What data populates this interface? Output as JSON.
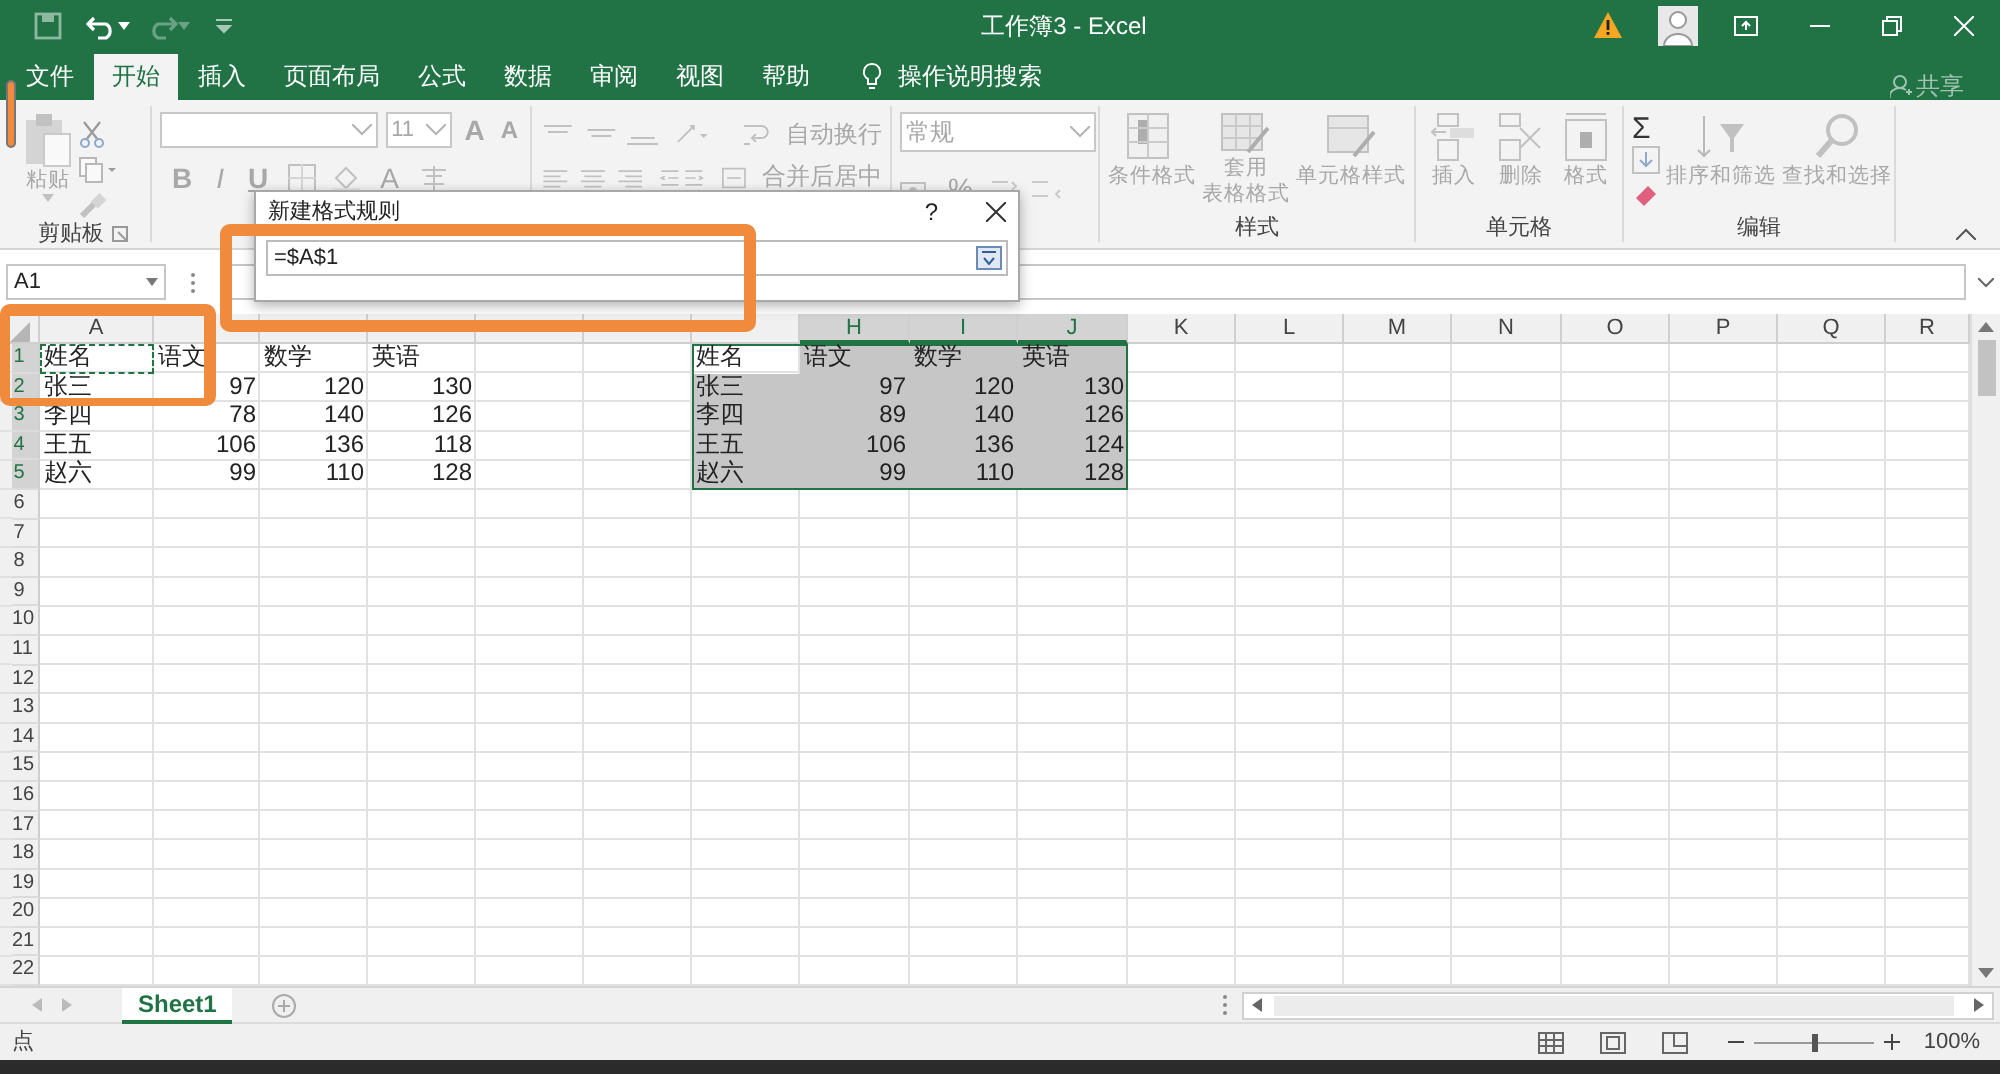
{
  "title_bar": {
    "title": "工作簿3 - Excel"
  },
  "tabs": [
    {
      "label": "文件",
      "selected": false
    },
    {
      "label": "开始",
      "selected": true
    },
    {
      "label": "插入",
      "selected": false
    },
    {
      "label": "页面布局",
      "selected": false
    },
    {
      "label": "公式",
      "selected": false
    },
    {
      "label": "数据",
      "selected": false
    },
    {
      "label": "审阅",
      "selected": false
    },
    {
      "label": "视图",
      "selected": false
    },
    {
      "label": "帮助",
      "selected": false
    }
  ],
  "tell_me": {
    "label": "操作说明搜索"
  },
  "share": {
    "label": "共享"
  },
  "ribbon": {
    "disabled": true,
    "clipboard": {
      "paste": "粘贴",
      "group_label": "剪贴板"
    },
    "font": {
      "size": "11",
      "grow": "A",
      "shrink": "A",
      "bold": "B",
      "italic": "I",
      "underline": "U",
      "text_color_button": "A"
    },
    "alignment": {
      "wrap_text": "自动换行",
      "merge_center": "合并后居中"
    },
    "number": {
      "format": "常规",
      "percent": "%"
    },
    "styles": {
      "conditional": "条件格式",
      "table_format": [
        "套用",
        "表格格式"
      ],
      "cell_styles": "单元格样式",
      "group_label": "样式"
    },
    "cells": {
      "insert": "插入",
      "delete": "删除",
      "format": "格式",
      "group_label": "单元格"
    },
    "editing": {
      "sum": "Σ",
      "sort_filter": "排序和筛选",
      "find_select": "查找和选择",
      "group_label": "编辑"
    }
  },
  "formula_bar": {
    "name_box": "A1"
  },
  "dialog": {
    "title": "新建格式规则",
    "help": "?",
    "formula": "=$A$1"
  },
  "sheet": {
    "columns": [
      {
        "label": "A",
        "selected": false
      },
      {
        "selected": false
      },
      {
        "selected": false
      },
      {
        "selected": false
      },
      {
        "selected": false
      },
      {
        "selected": false
      },
      {
        "selected": false
      },
      {
        "label": "H",
        "selected": true
      },
      {
        "label": "I",
        "selected": true
      },
      {
        "label": "J",
        "selected": true
      },
      {
        "label": "K",
        "selected": false
      },
      {
        "label": "L",
        "selected": false
      },
      {
        "label": "M",
        "selected": false
      },
      {
        "label": "N",
        "selected": false
      },
      {
        "label": "O",
        "selected": false
      },
      {
        "label": "P",
        "selected": false
      },
      {
        "label": "Q",
        "selected": false
      },
      {
        "label": "R",
        "selected": false
      }
    ],
    "rows": [
      {
        "label": "1",
        "selected": true
      },
      {
        "label": "2",
        "selected": true
      },
      {
        "label": "3",
        "selected": true
      },
      {
        "label": "4",
        "selected": true
      },
      {
        "label": "5",
        "selected": true
      },
      {
        "label": "6",
        "selected": false
      },
      {
        "label": "7",
        "selected": false
      },
      {
        "label": "8",
        "selected": false
      },
      {
        "label": "9",
        "selected": false
      },
      {
        "label": "10",
        "selected": false
      },
      {
        "label": "11",
        "selected": false
      },
      {
        "label": "12",
        "selected": false
      },
      {
        "label": "13",
        "selected": false
      },
      {
        "label": "14",
        "selected": false
      },
      {
        "label": "15",
        "selected": false
      },
      {
        "label": "16",
        "selected": false
      },
      {
        "label": "17",
        "selected": false
      },
      {
        "label": "18",
        "selected": false
      },
      {
        "label": "19",
        "selected": false
      },
      {
        "label": "20",
        "selected": false
      },
      {
        "label": "21",
        "selected": false
      },
      {
        "label": "22",
        "selected": false
      }
    ],
    "tables": [
      {
        "selected": false,
        "rows": [
          [
            {
              "text": "姓名",
              "kind": "text",
              "active": false,
              "marquee": true
            },
            {
              "text": "语文",
              "kind": "text",
              "active": false,
              "marquee": false
            },
            {
              "text": "数学",
              "kind": "text",
              "active": false,
              "marquee": false
            },
            {
              "text": "英语",
              "kind": "text",
              "active": false,
              "marquee": false
            }
          ],
          [
            {
              "text": "张三",
              "kind": "text",
              "active": false,
              "marquee": false
            },
            {
              "text": "97",
              "kind": "number",
              "active": false,
              "marquee": false
            },
            {
              "text": "120",
              "kind": "number",
              "active": false,
              "marquee": false
            },
            {
              "text": "130",
              "kind": "number",
              "active": false,
              "marquee": false
            }
          ],
          [
            {
              "text": "李四",
              "kind": "text",
              "active": false,
              "marquee": false
            },
            {
              "text": "78",
              "kind": "number",
              "active": false,
              "marquee": false
            },
            {
              "text": "140",
              "kind": "number",
              "active": false,
              "marquee": false
            },
            {
              "text": "126",
              "kind": "number",
              "active": false,
              "marquee": false
            }
          ],
          [
            {
              "text": "王五",
              "kind": "text",
              "active": false,
              "marquee": false
            },
            {
              "text": "106",
              "kind": "number",
              "active": false,
              "marquee": false
            },
            {
              "text": "136",
              "kind": "number",
              "active": false,
              "marquee": false
            },
            {
              "text": "118",
              "kind": "number",
              "active": false,
              "marquee": false
            }
          ],
          [
            {
              "text": "赵六",
              "kind": "text",
              "active": false,
              "marquee": false
            },
            {
              "text": "99",
              "kind": "number",
              "active": false,
              "marquee": false
            },
            {
              "text": "110",
              "kind": "number",
              "active": false,
              "marquee": false
            },
            {
              "text": "128",
              "kind": "number",
              "active": false,
              "marquee": false
            }
          ]
        ]
      },
      {
        "selected": true,
        "rows": [
          [
            {
              "text": "姓名",
              "kind": "text",
              "active": true,
              "marquee": false
            },
            {
              "text": "语文",
              "kind": "text",
              "active": false,
              "marquee": false
            },
            {
              "text": "数学",
              "kind": "text",
              "active": false,
              "marquee": false
            },
            {
              "text": "英语",
              "kind": "text",
              "active": false,
              "marquee": false
            }
          ],
          [
            {
              "text": "张三",
              "kind": "text",
              "active": false,
              "marquee": false
            },
            {
              "text": "97",
              "kind": "number",
              "active": false,
              "marquee": false
            },
            {
              "text": "120",
              "kind": "number",
              "active": false,
              "marquee": false
            },
            {
              "text": "130",
              "kind": "number",
              "active": false,
              "marquee": false
            }
          ],
          [
            {
              "text": "李四",
              "kind": "text",
              "active": false,
              "marquee": false
            },
            {
              "text": "89",
              "kind": "number",
              "active": false,
              "marquee": false
            },
            {
              "text": "140",
              "kind": "number",
              "active": false,
              "marquee": false
            },
            {
              "text": "126",
              "kind": "number",
              "active": false,
              "marquee": false
            }
          ],
          [
            {
              "text": "王五",
              "kind": "text",
              "active": false,
              "marquee": false
            },
            {
              "text": "106",
              "kind": "number",
              "active": false,
              "marquee": false
            },
            {
              "text": "136",
              "kind": "number",
              "active": false,
              "marquee": false
            },
            {
              "text": "124",
              "kind": "number",
              "active": false,
              "marquee": false
            }
          ],
          [
            {
              "text": "赵六",
              "kind": "text",
              "active": false,
              "marquee": false
            },
            {
              "text": "99",
              "kind": "number",
              "active": false,
              "marquee": false
            },
            {
              "text": "110",
              "kind": "number",
              "active": false,
              "marquee": false
            },
            {
              "text": "128",
              "kind": "number",
              "active": false,
              "marquee": false
            }
          ]
        ]
      }
    ]
  },
  "sheet_tabs": [
    {
      "label": "Sheet1",
      "selected": true
    }
  ],
  "status_bar": {
    "mode": "点",
    "zoom": "100%",
    "zoom_slider": {
      "level": 0.5
    }
  },
  "annotations": [
    {
      "kind": "frame"
    },
    {
      "kind": "frame"
    }
  ]
}
